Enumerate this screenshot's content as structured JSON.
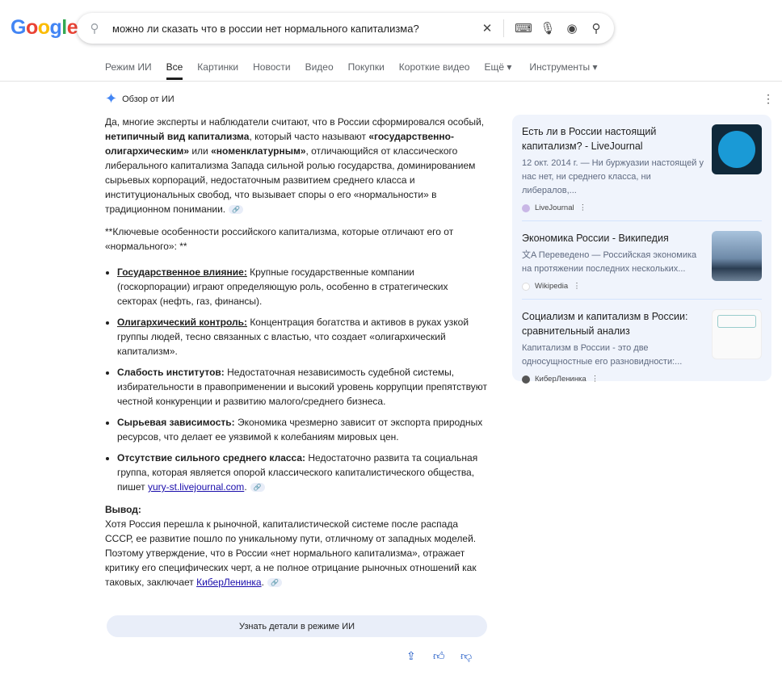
{
  "logo": "Google",
  "search": {
    "query": "можно ли сказать что в россии нет нормального капитализма?"
  },
  "tabs": [
    "Режим ИИ",
    "Все",
    "Картинки",
    "Новости",
    "Видео",
    "Покупки",
    "Короткие видео",
    "Ещё ▾",
    "Инструменты ▾"
  ],
  "ai": {
    "title": "Обзор от ИИ",
    "intro": [
      "Да, многие эксперты и наблюдатели считают, что в России сформировался особый, ",
      "нетипичный вид капитализма",
      ", который часто называют ",
      "«государственно-олигархическим»",
      " или ",
      "«номенклатурным»",
      ", отличающийся от классического либерального капитализма Запада сильной ролью государства, доминированием сырьевых корпораций, недостаточным развитием среднего класса и институциональных свобод, что вызывает споры о его «нормальности» в традиционном понимании."
    ],
    "features_heading": "**Ключевые особенности российского капитализма, которые отличают его от «нормального»: **",
    "bullets": [
      {
        "b": "Государственное влияние:",
        "t": " Крупные государственные компании (госкорпорации) играют определяющую роль, особенно в стратегических секторах (нефть, газ, финансы)."
      },
      {
        "b": "Олигархический контроль:",
        "t": " Концентрация богатства и активов в руках узкой группы людей, тесно связанных с властью, что создает «олигархический капитализм»."
      },
      {
        "b": "Слабость институтов:",
        "t": " Недостаточная независимость судебной системы, избирательности в правоприменении и высокий уровень коррупции препятствуют честной конкуренции и развитию малого/среднего бизнеса."
      },
      {
        "b": "Сырьевая зависимость:",
        "t": " Экономика чрезмерно зависит от экспорта природных ресурсов, что делает ее уязвимой к колебаниям мировых цен."
      },
      {
        "b": "Отсутствие сильного среднего класса:",
        "t": " Недостаточно развита та социальная группа, которая является опорой классического капиталистического общества, пишет ",
        "link": "yury-st.livejournal.com",
        "end": "."
      }
    ],
    "conclusion_label": "Вывод:",
    "conclusion": "Хотя Россия перешла к рыночной, капиталистической системе после распада СССР, ее развитие пошло по уникальному пути, отличному от западных моделей. Поэтому утверждение, что в России «нет нормального капитализма», отражает критику его специфических черт, а не полное отрицание рыночных отношений как таковых, заключает ",
    "conclusion_link": "КиберЛенинка",
    "more_button": "Узнать детали в режиме ИИ"
  },
  "sources": [
    {
      "title": "Есть ли в России настоящий капитализм? - LiveJournal",
      "snippet": "12 окт. 2014 г. — Ни буржуазии настоящей у нас нет, ни среднего класса, ни либералов,...",
      "site": "LiveJournal"
    },
    {
      "title": "Экономика России - Википедия",
      "snippet": "文A Переведено — Российская экономика на протяжении последних нескольких...",
      "site": "Wikipedia"
    },
    {
      "title": "Социализм и капитализм в России: сравнительный анализ",
      "snippet": "Капитализм в России - это две односущностные его разновидности:...",
      "site": "КиберЛенинка"
    }
  ]
}
